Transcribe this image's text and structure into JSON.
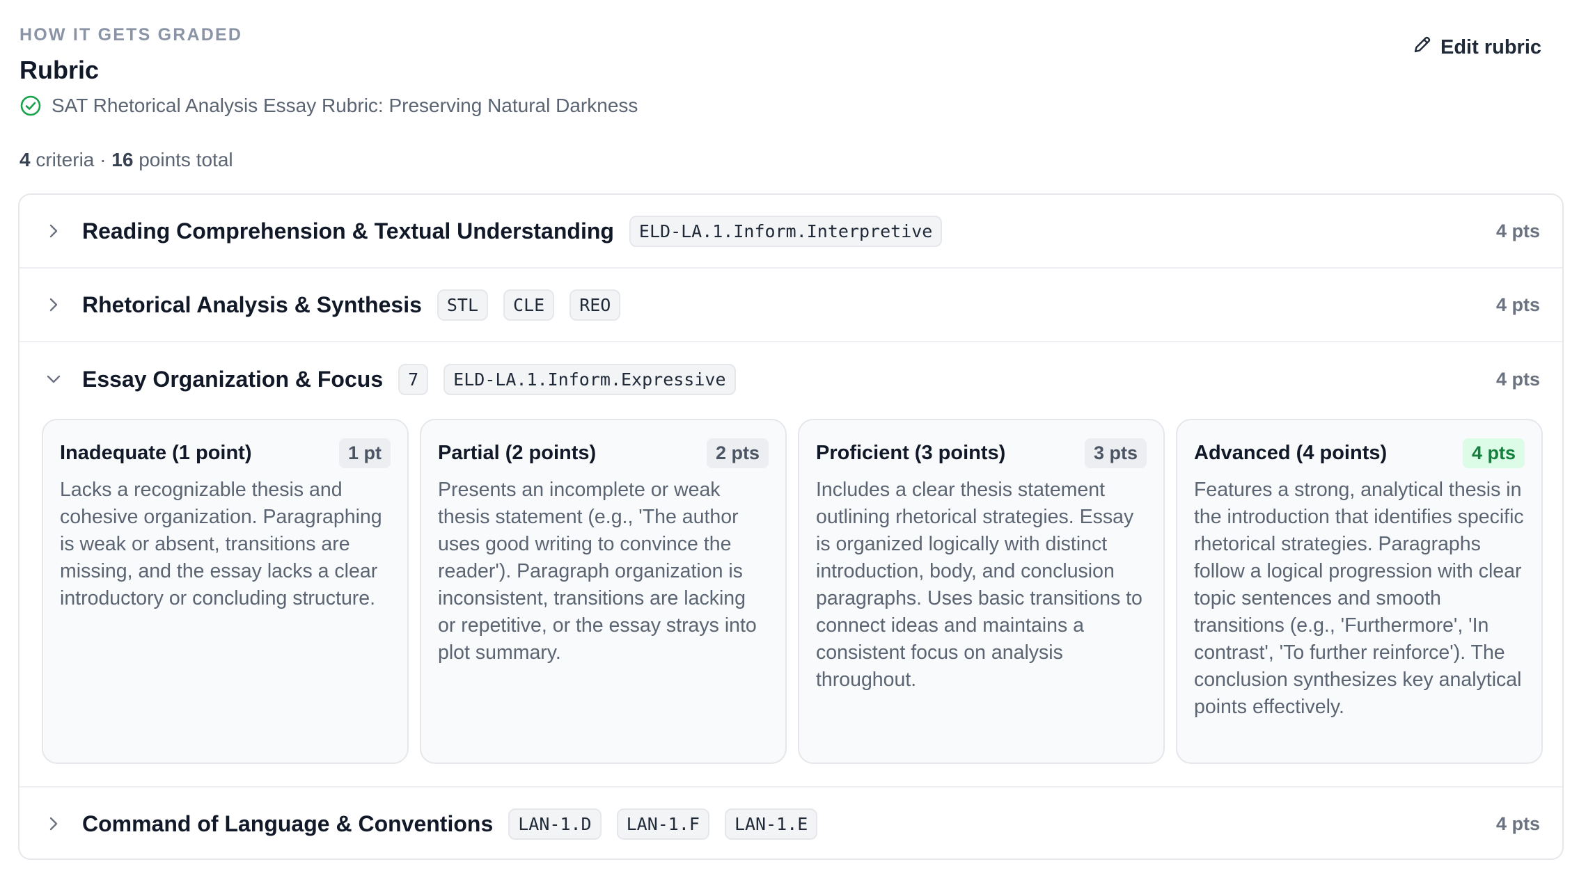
{
  "header": {
    "eyebrow": "HOW IT GETS GRADED",
    "title": "Rubric",
    "rubric_name": "SAT Rhetorical Analysis Essay Rubric: Preserving Natural Darkness",
    "edit_label": "Edit rubric"
  },
  "summary": {
    "criteria_count": "4",
    "criteria_label": "criteria ·",
    "points_total": "16",
    "points_label": "points total"
  },
  "criteria": [
    {
      "title": "Reading Comprehension & Textual Understanding",
      "tags": [
        "ELD-LA.1.Inform.Interpretive"
      ],
      "points": "4 pts",
      "expanded": false
    },
    {
      "title": "Rhetorical Analysis & Synthesis",
      "tags": [
        "STL",
        "CLE",
        "REO"
      ],
      "points": "4 pts",
      "expanded": false
    },
    {
      "title": "Essay Organization & Focus",
      "tags": [
        "7",
        "ELD-LA.1.Inform.Expressive"
      ],
      "points": "4 pts",
      "expanded": true,
      "levels": [
        {
          "title": "Inadequate (1 point)",
          "points": "1 pt",
          "description": "Lacks a recognizable thesis and cohesive organization. Paragraphing is weak or absent, transitions are missing, and the essay lacks a clear introductory or concluding structure."
        },
        {
          "title": "Partial (2 points)",
          "points": "2 pts",
          "description": "Presents an incomplete or weak thesis statement (e.g., 'The author uses good writing to convince the reader'). Paragraph organization is inconsistent, transitions are lacking or repetitive, or the essay strays into plot summary."
        },
        {
          "title": "Proficient (3 points)",
          "points": "3 pts",
          "description": "Includes a clear thesis statement outlining rhetorical strategies. Essay is organized logically with distinct introduction, body, and conclusion paragraphs. Uses basic transitions to connect ideas and maintains a consistent focus on analysis throughout."
        },
        {
          "title": "Advanced (4 points)",
          "points": "4 pts",
          "description": "Features a strong, analytical thesis in the introduction that identifies specific rhetorical strategies. Paragraphs follow a logical progression with clear topic sentences and smooth transitions (e.g., 'Furthermore', 'In contrast', 'To further reinforce'). The conclusion synthesizes key analytical points effectively."
        }
      ]
    },
    {
      "title": "Command of Language & Conventions",
      "tags": [
        "LAN-1.D",
        "LAN-1.F",
        "LAN-1.E"
      ],
      "points": "4 pts",
      "expanded": false
    }
  ],
  "colors": {
    "accent_green": "#15803d",
    "top_badge_bg": "#dcfce7",
    "muted_text": "#5b6472"
  },
  "icons": {
    "check": "check-circle-icon",
    "edit": "pencil-icon",
    "collapsed": "chevron-right-icon",
    "expanded": "chevron-down-icon"
  }
}
